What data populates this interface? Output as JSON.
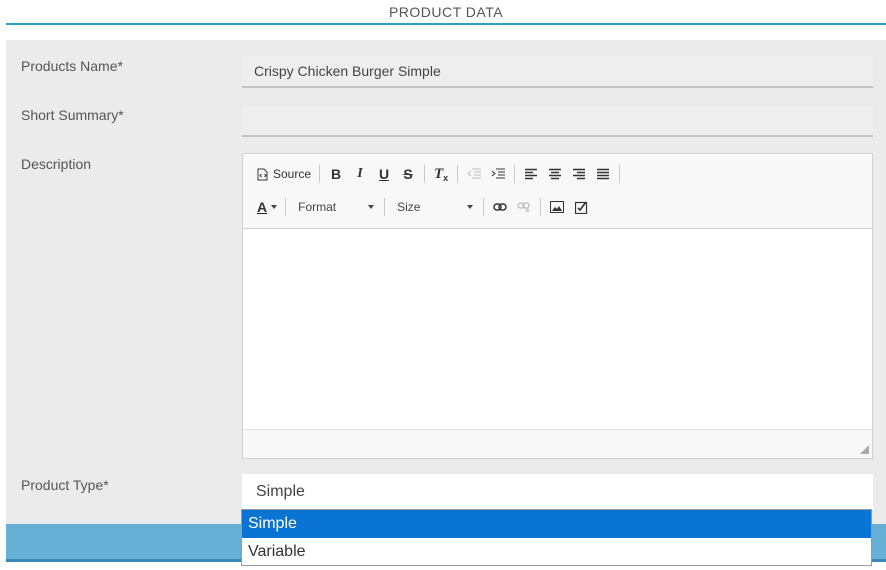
{
  "section": {
    "title": "PRODUCT DATA"
  },
  "form": {
    "product_name": {
      "label": "Products Name*",
      "value": "Crispy Chicken Burger Simple"
    },
    "short_summary": {
      "label": "Short Summary*",
      "value": ""
    },
    "description": {
      "label": "Description"
    },
    "product_type": {
      "label": "Product Type*",
      "value": "Simple",
      "options": [
        "Simple",
        "Variable"
      ],
      "highlighted": "Simple"
    }
  },
  "editor": {
    "toolbar": {
      "source_label": "Source",
      "bold": "B",
      "italic": "I",
      "underline": "U",
      "strike": "S",
      "remove_format": "T",
      "text_color": "A",
      "format_label": "Format",
      "size_label": "Size"
    }
  },
  "colors": {
    "accent": "#2aa0cd",
    "selected_option": "#0a74d4",
    "bar": "#66b0d6"
  }
}
